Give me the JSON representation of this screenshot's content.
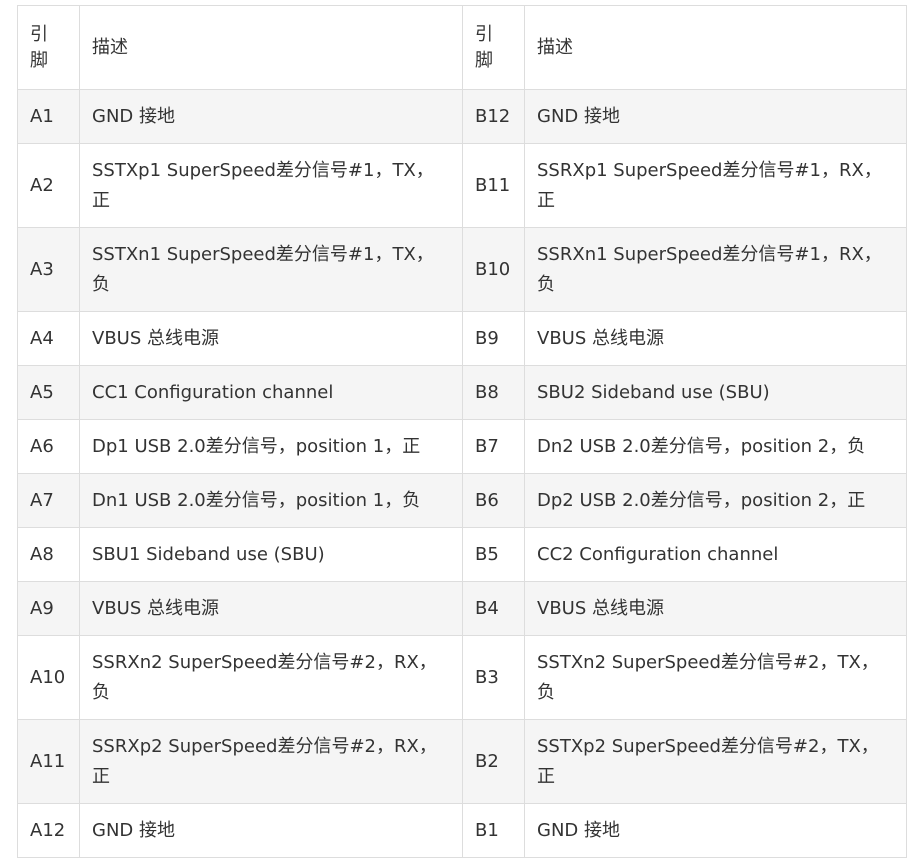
{
  "table": {
    "headers": {
      "pin": "引脚",
      "description": "描述"
    },
    "rows": [
      {
        "pin_a": "A1",
        "desc_a": "GND 接地",
        "pin_b": "B12",
        "desc_b": "GND 接地"
      },
      {
        "pin_a": "A2",
        "desc_a": "SSTXp1 SuperSpeed差分信号#1，TX，正",
        "pin_b": "B11",
        "desc_b": "SSRXp1 SuperSpeed差分信号#1，RX，正"
      },
      {
        "pin_a": "A3",
        "desc_a": "SSTXn1 SuperSpeed差分信号#1，TX，负",
        "pin_b": "B10",
        "desc_b": "SSRXn1 SuperSpeed差分信号#1，RX，负"
      },
      {
        "pin_a": "A4",
        "desc_a": "VBUS 总线电源",
        "pin_b": "B9",
        "desc_b": "VBUS 总线电源"
      },
      {
        "pin_a": "A5",
        "desc_a": "CC1 Configuration channel",
        "pin_b": "B8",
        "desc_b": "SBU2 Sideband use (SBU)"
      },
      {
        "pin_a": "A6",
        "desc_a": "Dp1 USB 2.0差分信号，position 1，正",
        "pin_b": "B7",
        "desc_b": "Dn2 USB 2.0差分信号，position 2，负"
      },
      {
        "pin_a": "A7",
        "desc_a": "Dn1 USB 2.0差分信号，position 1，负",
        "pin_b": "B6",
        "desc_b": "Dp2 USB 2.0差分信号，position 2，正"
      },
      {
        "pin_a": "A8",
        "desc_a": "SBU1 Sideband use (SBU)",
        "pin_b": "B5",
        "desc_b": "CC2 Configuration channel"
      },
      {
        "pin_a": "A9",
        "desc_a": "VBUS 总线电源",
        "pin_b": "B4",
        "desc_b": "VBUS 总线电源"
      },
      {
        "pin_a": "A10",
        "desc_a": "SSRXn2 SuperSpeed差分信号#2，RX，负",
        "pin_b": "B3",
        "desc_b": "SSTXn2 SuperSpeed差分信号#2，TX，负"
      },
      {
        "pin_a": "A11",
        "desc_a": "SSRXp2 SuperSpeed差分信号#2，RX，正",
        "pin_b": "B2",
        "desc_b": "SSTXp2 SuperSpeed差分信号#2，TX，正"
      },
      {
        "pin_a": "A12",
        "desc_a": "GND 接地",
        "pin_b": "B1",
        "desc_b": "GND 接地"
      }
    ]
  }
}
